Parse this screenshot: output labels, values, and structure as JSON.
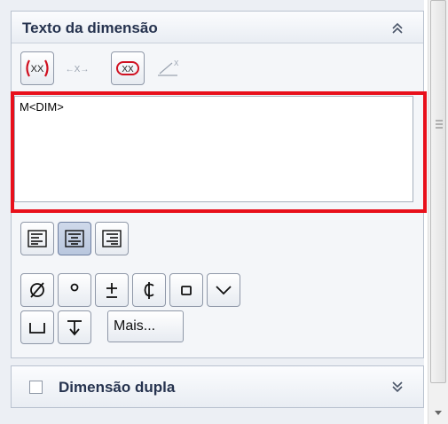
{
  "panel": {
    "group_title": "Texto da dimensão",
    "group_collapse_icon": "double-chevron-up-icon",
    "toolbar_icons": [
      "parentheses-xx-icon",
      "inspection-xx-icon-disabled",
      "rounded-xx-icon",
      "tolerance-slash-icon-disabled"
    ],
    "text_value": "M<DIM>",
    "align_icons": [
      "align-left-icon",
      "align-center-icon",
      "align-right-icon"
    ],
    "align_selected": "center",
    "symbol_icons": [
      "diameter-icon",
      "degree-icon",
      "plus-minus-icon",
      "centerline-icon",
      "square-icon",
      "chevron-down-icon",
      "counterbore-icon",
      "depth-icon"
    ],
    "more_label": "Mais...",
    "second_group_title": "Dimensão dupla",
    "second_group_checked": false,
    "second_group_expand_icon": "double-chevron-down-icon"
  },
  "colors": {
    "highlight": "#e8101b",
    "selected_button": "#c3cfe3",
    "title_text": "#26334f",
    "panel_background": "#eceff4"
  }
}
